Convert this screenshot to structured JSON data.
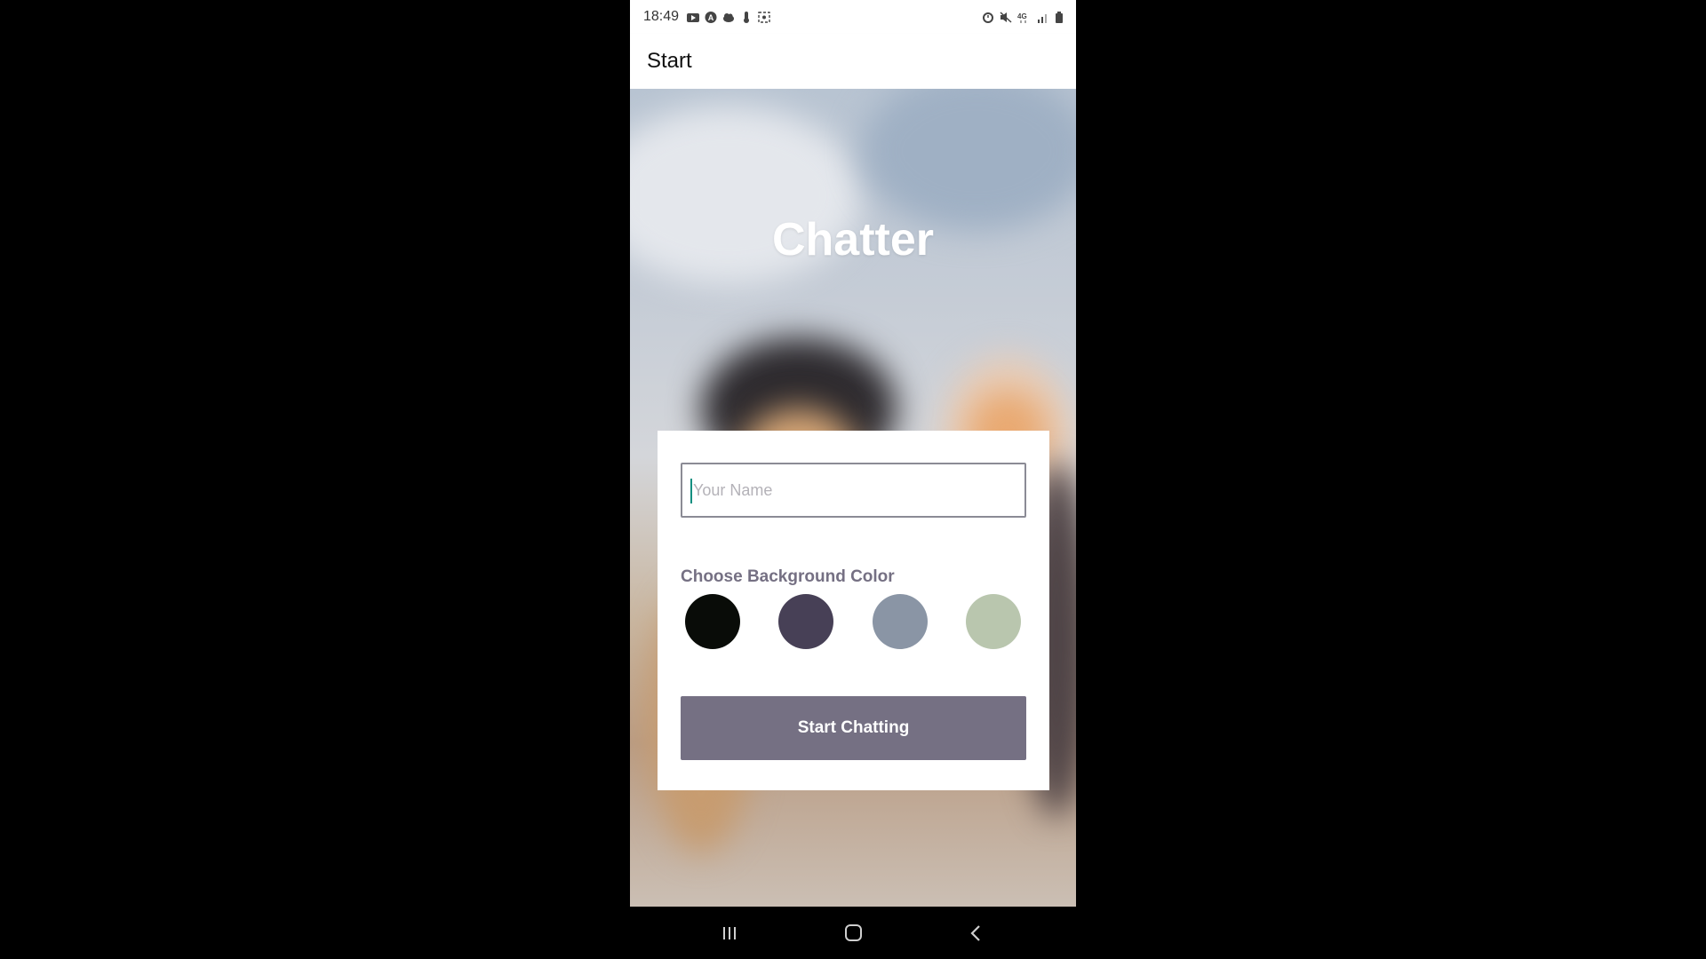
{
  "status_bar": {
    "time": "18:49",
    "left_icons": [
      "youtube-icon",
      "a-circle-icon",
      "cloud-icon",
      "thermometer-icon",
      "screenshot-icon"
    ],
    "right_icons": [
      "alarm-icon",
      "mute-icon",
      "network-4g-icon",
      "signal-icon",
      "battery-icon"
    ]
  },
  "app_bar": {
    "title": "Start"
  },
  "main": {
    "app_title": "Chatter",
    "name_input": {
      "placeholder": "Your Name",
      "value": ""
    },
    "color_label": "Choose Background Color",
    "colors": [
      {
        "name": "black",
        "hex": "#090C08"
      },
      {
        "name": "purple",
        "hex": "#474056"
      },
      {
        "name": "grey-blue",
        "hex": "#8A95A5"
      },
      {
        "name": "sage-green",
        "hex": "#B9C6AE"
      }
    ],
    "start_button": "Start Chatting"
  },
  "nav_bar": {
    "icons": [
      "recent-apps-icon",
      "home-icon",
      "back-icon"
    ]
  },
  "colors": {
    "accent": "#757083",
    "caret": "#0d8f80"
  }
}
